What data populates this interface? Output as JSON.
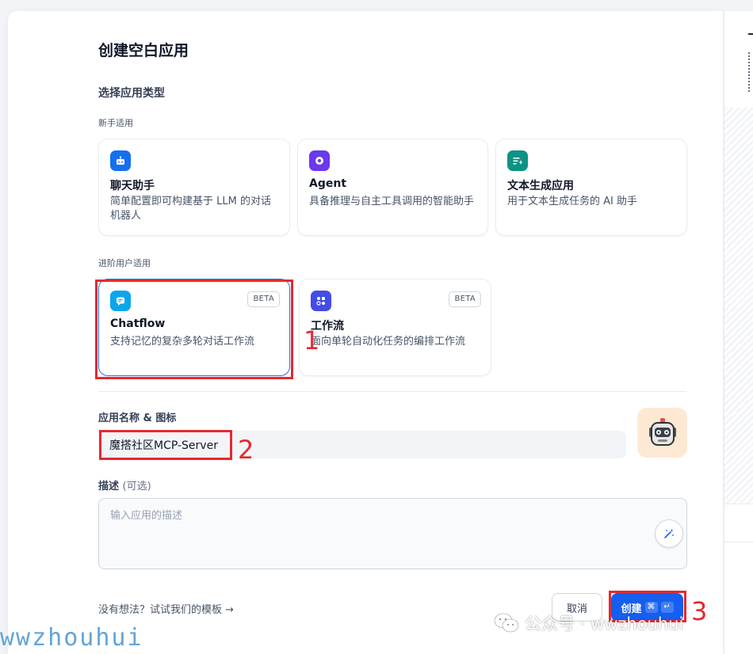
{
  "dialog": {
    "title": "创建空白应用",
    "section_title": "选择应用类型",
    "beginner_label": "新手适用",
    "advanced_label": "进阶用户适用"
  },
  "app_types": {
    "chat": {
      "title": "聊天助手",
      "desc": "简单配置即可构建基于 LLM 的对话机器人",
      "icon": "chat-bot-icon",
      "color": "#1570ef"
    },
    "agent": {
      "title": "Agent",
      "desc": "具备推理与自主工具调用的智能助手",
      "icon": "agent-icon",
      "color": "#6938ef"
    },
    "textgen": {
      "title": "文本生成应用",
      "desc": "用于文本生成任务的 AI 助手",
      "icon": "text-generation-icon",
      "color": "#0e9384"
    },
    "chatflow": {
      "title": "Chatflow",
      "desc": "支持记忆的复杂多轮对话工作流",
      "badge": "BETA",
      "icon": "chatflow-icon",
      "color": "#0ba5ec"
    },
    "workflow": {
      "title": "工作流",
      "desc": "面向单轮自动化任务的编排工作流",
      "badge": "BETA",
      "icon": "workflow-icon",
      "color": "#444ce7"
    }
  },
  "name_field": {
    "label": "应用名称 & 图标",
    "value": "魔搭社区MCP-Server"
  },
  "desc_field": {
    "label": "描述",
    "optional": "(可选)",
    "placeholder": "输入应用的描述"
  },
  "footer": {
    "template_link": "没有想法？试试我们的模板",
    "template_arrow": "→",
    "cancel_label": "取消",
    "create_label": "创建",
    "shortcut_cmd": "⌘",
    "shortcut_enter": "↵"
  },
  "annotations": [
    "1",
    "2",
    "3"
  ],
  "watermark": {
    "left_text": "wwzhouhui",
    "wechat_text": "公众号 · wwzhouhui"
  }
}
